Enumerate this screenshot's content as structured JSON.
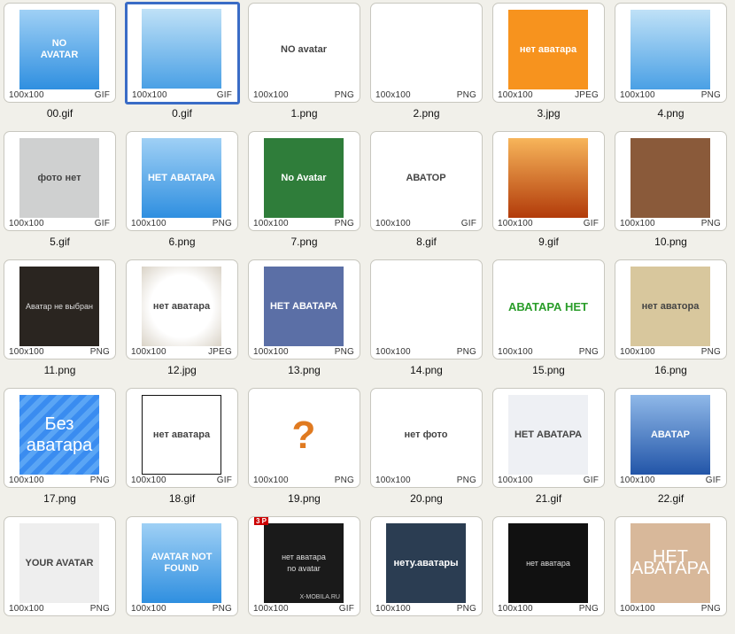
{
  "tiles": [
    {
      "name": "00.gif",
      "dims": "100x100",
      "type": "GIF",
      "text": "NO\nAVATAR",
      "style": "blue",
      "selected": false
    },
    {
      "name": "0.gif",
      "dims": "100x100",
      "type": "GIF",
      "text": "",
      "style": "person",
      "selected": true
    },
    {
      "name": "1.png",
      "dims": "100x100",
      "type": "PNG",
      "text": "NO avatar",
      "style": "green-tag",
      "selected": false
    },
    {
      "name": "2.png",
      "dims": "100x100",
      "type": "PNG",
      "text": "",
      "style": "msn",
      "selected": false
    },
    {
      "name": "3.jpg",
      "dims": "100x100",
      "type": "JPEG",
      "text": "нет аватара",
      "style": "orange",
      "selected": false
    },
    {
      "name": "4.png",
      "dims": "100x100",
      "type": "PNG",
      "text": "",
      "style": "boy",
      "selected": false
    },
    {
      "name": "5.gif",
      "dims": "100x100",
      "type": "GIF",
      "text": "фото нет",
      "style": "gray",
      "selected": false
    },
    {
      "name": "6.png",
      "dims": "100x100",
      "type": "PNG",
      "text": "НЕТ АВАТАРА",
      "style": "blue-sm",
      "selected": false
    },
    {
      "name": "7.png",
      "dims": "100x100",
      "type": "PNG",
      "text": "No Avatar",
      "style": "green-dark",
      "selected": false
    },
    {
      "name": "8.gif",
      "dims": "100x100",
      "type": "GIF",
      "text": "АВАТОР",
      "style": "fs",
      "selected": false
    },
    {
      "name": "9.gif",
      "dims": "100x100",
      "type": "GIF",
      "text": "",
      "style": "camera",
      "selected": false
    },
    {
      "name": "10.png",
      "dims": "100x100",
      "type": "PNG",
      "text": "",
      "style": "camera2",
      "selected": false
    },
    {
      "name": "11.png",
      "dims": "100x100",
      "type": "PNG",
      "text": "Аватар не выбран",
      "style": "dark",
      "selected": false
    },
    {
      "name": "12.jpg",
      "dims": "100x100",
      "type": "JPEG",
      "text": "нет аватара",
      "style": "white-vign",
      "selected": false
    },
    {
      "name": "13.png",
      "dims": "100x100",
      "type": "PNG",
      "text": "НЕТ АВАТАРА",
      "style": "heart",
      "selected": false
    },
    {
      "name": "14.png",
      "dims": "100x100",
      "type": "PNG",
      "text": "",
      "style": "msn2",
      "selected": false
    },
    {
      "name": "15.png",
      "dims": "100x100",
      "type": "PNG",
      "text": "АВАТАРА НЕТ",
      "style": "tweety",
      "selected": false
    },
    {
      "name": "16.png",
      "dims": "100x100",
      "type": "PNG",
      "text": "нет аватора",
      "style": "knight",
      "selected": false
    },
    {
      "name": "17.png",
      "dims": "100x100",
      "type": "PNG",
      "text": "Без аватара",
      "style": "stripes",
      "selected": false
    },
    {
      "name": "18.gif",
      "dims": "100x100",
      "type": "GIF",
      "text": "нет аватара",
      "style": "silhouette",
      "selected": false
    },
    {
      "name": "19.png",
      "dims": "100x100",
      "type": "PNG",
      "text": "?",
      "style": "question",
      "selected": false
    },
    {
      "name": "20.png",
      "dims": "100x100",
      "type": "PNG",
      "text": "нет фото",
      "style": "bear",
      "selected": false
    },
    {
      "name": "21.gif",
      "dims": "100x100",
      "type": "GIF",
      "text": "НЕТ АВАТАРА",
      "style": "frame",
      "selected": false
    },
    {
      "name": "22.gif",
      "dims": "100x100",
      "type": "GIF",
      "text": "АВАТАР",
      "style": "navy",
      "selected": false
    },
    {
      "name": "",
      "dims": "100x100",
      "type": "PNG",
      "text": "YOUR AVATAR",
      "style": "glasses",
      "selected": false
    },
    {
      "name": "",
      "dims": "100x100",
      "type": "PNG",
      "text": "AVATAR NOT FOUND",
      "style": "blue-nf",
      "selected": false
    },
    {
      "name": "",
      "dims": "100x100",
      "type": "GIF",
      "text": "нет аватара\nno avatar",
      "style": "noise",
      "badge": "3 P",
      "credit": "X-MOBILA.RU",
      "selected": false
    },
    {
      "name": "",
      "dims": "100x100",
      "type": "PNG",
      "text": "нету.аватары",
      "style": "navy2",
      "selected": false
    },
    {
      "name": "",
      "dims": "100x100",
      "type": "PNG",
      "text": "нет аватара",
      "style": "black",
      "selected": false
    },
    {
      "name": "",
      "dims": "100x100",
      "type": "PNG",
      "text": "НЕТ АВАТАРА",
      "style": "beige",
      "selected": false
    }
  ],
  "colors": {
    "selection": "#3a6cc6",
    "background": "#f1f0ea"
  }
}
